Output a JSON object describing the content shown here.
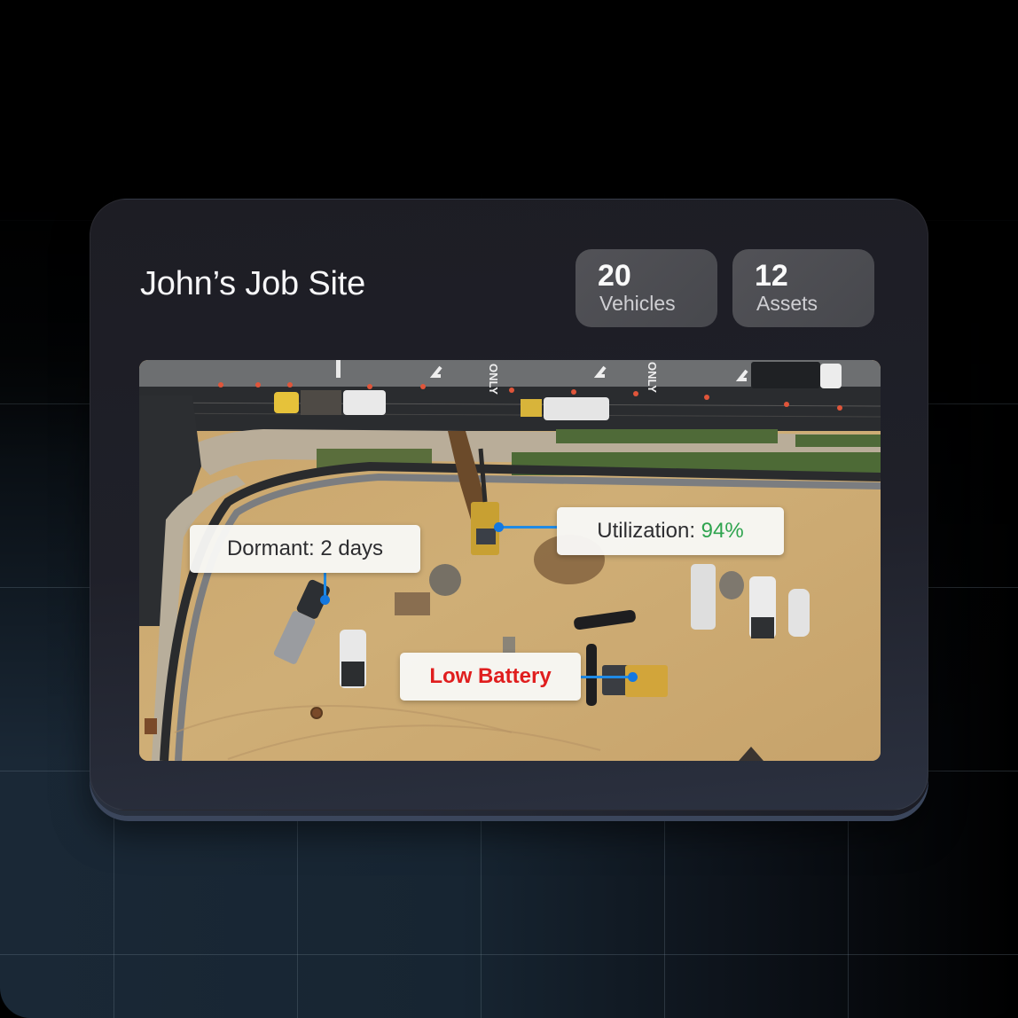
{
  "site": {
    "title": "John’s Job Site"
  },
  "stats": [
    {
      "value": "20",
      "label": "Vehicles"
    },
    {
      "value": "12",
      "label": "Assets"
    }
  ],
  "photo": {
    "description": "aerial-construction-site",
    "road_markings": [
      "ONLY",
      "ONLY"
    ]
  },
  "annotations": {
    "dormant": {
      "prefix": "Dormant: ",
      "value": "2 days"
    },
    "utilization": {
      "prefix": "Utilization: ",
      "value": "94%",
      "value_color": "#2fa44f"
    },
    "battery": {
      "text": "Low Battery",
      "color": "#e01e1e"
    }
  },
  "colors": {
    "pin": "#1478e0",
    "accent_green": "#2fa44f",
    "alert_red": "#e01e1e"
  }
}
